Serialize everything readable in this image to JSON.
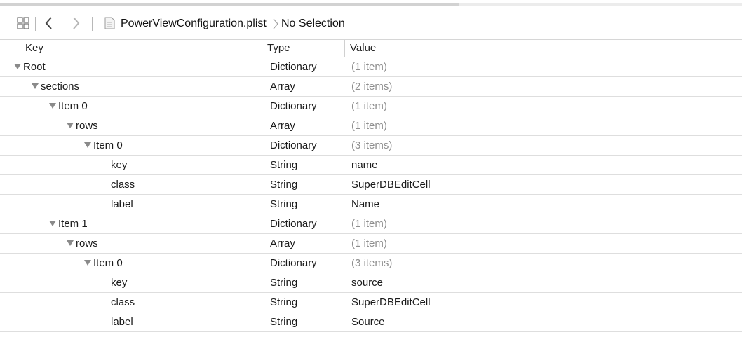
{
  "jump_bar": {
    "file_name": "PowerViewConfiguration.plist",
    "selection": "No Selection"
  },
  "columns": {
    "key": "Key",
    "type": "Type",
    "value": "Value"
  },
  "rows": [
    {
      "key": "Root",
      "type": "Dictionary",
      "value": "(1 item)",
      "expandable": true,
      "indent": 0
    },
    {
      "key": "sections",
      "type": "Array",
      "value": "(2 items)",
      "expandable": true,
      "indent": 1
    },
    {
      "key": "Item 0",
      "type": "Dictionary",
      "value": "(1 item)",
      "expandable": true,
      "indent": 2
    },
    {
      "key": "rows",
      "type": "Array",
      "value": "(1 item)",
      "expandable": true,
      "indent": 3
    },
    {
      "key": "Item 0",
      "type": "Dictionary",
      "value": "(3 items)",
      "expandable": true,
      "indent": 4
    },
    {
      "key": "key",
      "type": "String",
      "value": "name",
      "expandable": false,
      "indent": 5
    },
    {
      "key": "class",
      "type": "String",
      "value": "SuperDBEditCell",
      "expandable": false,
      "indent": 5
    },
    {
      "key": "label",
      "type": "String",
      "value": "Name",
      "expandable": false,
      "indent": 5
    },
    {
      "key": "Item 1",
      "type": "Dictionary",
      "value": "(1 item)",
      "expandable": true,
      "indent": 2
    },
    {
      "key": "rows",
      "type": "Array",
      "value": "(1 item)",
      "expandable": true,
      "indent": 3
    },
    {
      "key": "Item 0",
      "type": "Dictionary",
      "value": "(3 items)",
      "expandable": true,
      "indent": 4
    },
    {
      "key": "key",
      "type": "String",
      "value": "source",
      "expandable": false,
      "indent": 5
    },
    {
      "key": "class",
      "type": "String",
      "value": "SuperDBEditCell",
      "expandable": false,
      "indent": 5
    },
    {
      "key": "label",
      "type": "String",
      "value": "Source",
      "expandable": false,
      "indent": 5
    }
  ]
}
